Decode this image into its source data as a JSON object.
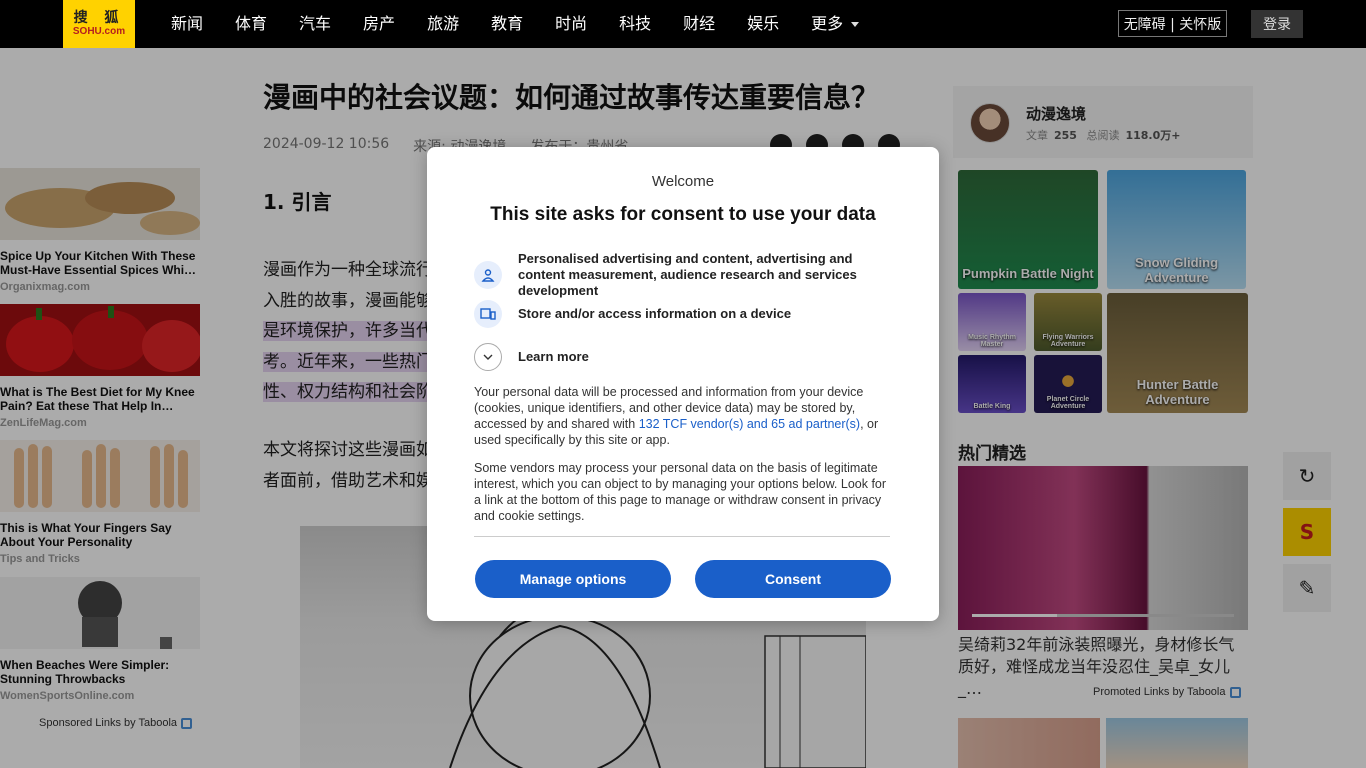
{
  "header": {
    "logo_text": "搜 狐",
    "logo_sub": "SOHU.com",
    "nav": [
      "新闻",
      "体育",
      "汽车",
      "房产",
      "旅游",
      "教育",
      "时尚",
      "科技",
      "财经",
      "娱乐"
    ],
    "more_label": "更多",
    "accessibility_label": "无障碍 | 关怀版",
    "login_label": "登录"
  },
  "article": {
    "title": "漫画中的社会议题：如何通过故事传达重要信息？",
    "date": "2024-09-12 10:56",
    "source": "来源: 动漫逸境",
    "published_in": "发布于：贵州省",
    "section_heading": "1. 引言",
    "paragraph1": [
      "漫画作为一种全球流行的",
      "入胜的故事，漫画能够巧",
      "是环境保护，许多当代漫",
      "考。近年来，一些热门作",
      "性、权力结构和社会阶层"
    ],
    "paragraph2": [
      "本文将探讨这些漫画如何",
      "者面前，借助艺术和娱乐"
    ]
  },
  "left_ads": [
    {
      "title": "Spice Up Your Kitchen With These Must-Have Essential Spices Whi…",
      "source": "Organixmag.com"
    },
    {
      "title": "What is The Best Diet for My Knee Pain? Eat these That Help In…",
      "source": "ZenLifeMag.com"
    },
    {
      "title": "This is What Your Fingers Say About Your Personality",
      "source": "Tips and Tricks"
    },
    {
      "title": "When Beaches Were Simpler: Stunning Throwbacks",
      "source": "WomenSportsOnline.com"
    }
  ],
  "sponsored_label": "Sponsored Links by Taboola",
  "author": {
    "name": "动漫逸境",
    "articles_label": "文章",
    "articles_count": "255",
    "reads_label": "总阅读",
    "reads_count": "118.0万+"
  },
  "games": [
    "Pumpkin Battle Night",
    "Snow Gliding Adventure",
    "Music Rhythm Master",
    "Flying Warriors Adventure",
    "Battle King",
    "Planet Circle Adventure",
    "Hunter Battle Adventure"
  ],
  "hot": {
    "title": "热门精选",
    "caption": "吴绮莉32年前泳装照曝光，身材修长气质好，难怪成龙当年没忍住_吴卓_女儿_…",
    "promoted_label": "Promoted Links by Taboola"
  },
  "tools": {
    "refresh_icon": "↻",
    "sohu_icon": "S",
    "edit_icon": "✎"
  },
  "consent": {
    "welcome": "Welcome",
    "heading": "This site asks for consent to use your data",
    "purposes": [
      "Personalised advertising and content, advertising and content measurement, audience research and services development",
      "Store and/or access information on a device"
    ],
    "learn_more": "Learn more",
    "body1_before": "Your personal data will be processed and information from your device (cookies, unique identifiers, and other device data) may be stored by, accessed by and shared with ",
    "body1_link": "132 TCF vendor(s) and 65 ad partner(s)",
    "body1_after": ", or used specifically by this site or app.",
    "body2": "Some vendors may process your personal data on the basis of legitimate interest, which you can object to by managing your options below. Look for a link at the bottom of this page to manage or withdraw consent in privacy and cookie settings.",
    "manage_label": "Manage options",
    "consent_label": "Consent"
  },
  "colors": {
    "brand_yellow": "#ffd200",
    "consent_blue": "#1a5fc9",
    "highlight": "#e6d4f2"
  }
}
